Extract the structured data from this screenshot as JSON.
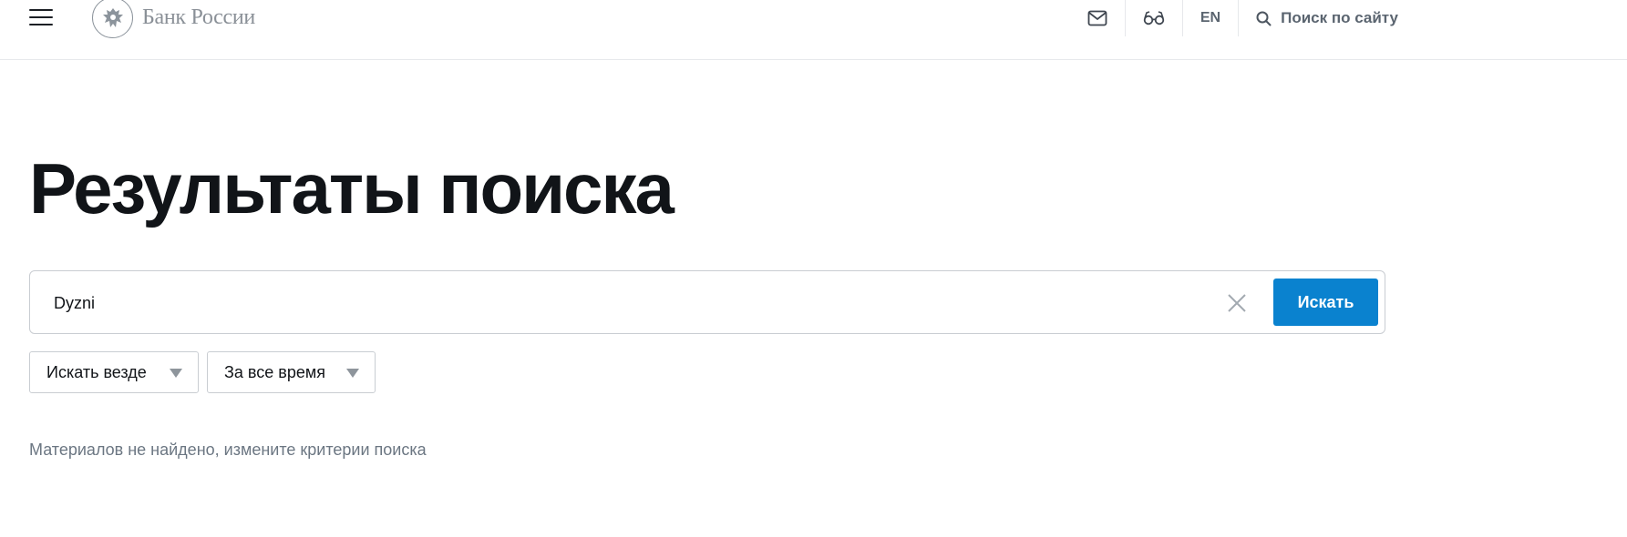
{
  "header": {
    "logo_text": "Банк России",
    "lang_label": "EN",
    "search_label": "Поиск по сайту",
    "icons": [
      "menu-icon",
      "emblem-icon",
      "mail-icon",
      "glasses-icon",
      "search-icon"
    ]
  },
  "page_title": "Результаты поиска",
  "search": {
    "query": "Dyzni",
    "submit_label": "Искать"
  },
  "filters": [
    {
      "label": "Искать везде"
    },
    {
      "label": "За все время"
    }
  ],
  "empty_message": "Материалов не найдено, измените критерии поиска",
  "colors": {
    "accent": "#0a82cf",
    "muted_text": "#6b7682",
    "border": "#c9cdd2"
  }
}
